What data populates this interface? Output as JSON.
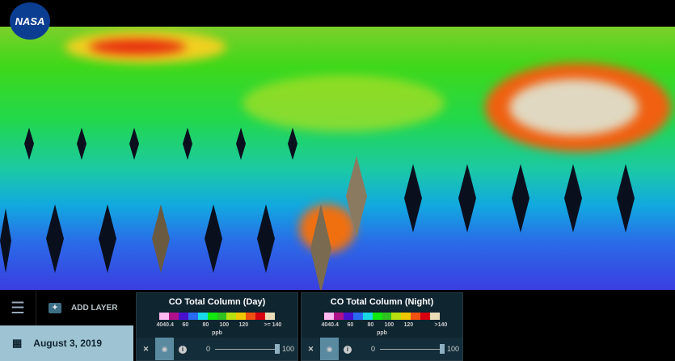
{
  "logo": "NASA",
  "sidebar": {
    "add_layer": "ADD LAYER",
    "date": "August 3, 2019"
  },
  "layers": [
    {
      "title": "CO Total Column (Day)",
      "ticks": [
        "4040.4",
        "60",
        "80",
        "100",
        "120",
        ">= 140"
      ],
      "unit": "ppb",
      "opacity_min": "0",
      "opacity_max": "100",
      "opacity": 100
    },
    {
      "title": "CO Total Column (Night)",
      "ticks": [
        "4040.4",
        "60",
        "80",
        "100",
        "120",
        ">140"
      ],
      "unit": "ppb",
      "opacity_min": "0",
      "opacity_max": "100",
      "opacity": 100
    }
  ],
  "colorbar": [
    "#ffb8f0",
    "#b0108a",
    "#4a10d0",
    "#2a6af0",
    "#18d8e8",
    "#10e810",
    "#30c020",
    "#b8e010",
    "#f0c800",
    "#f05010",
    "#d80010",
    "#e8dcb8"
  ]
}
